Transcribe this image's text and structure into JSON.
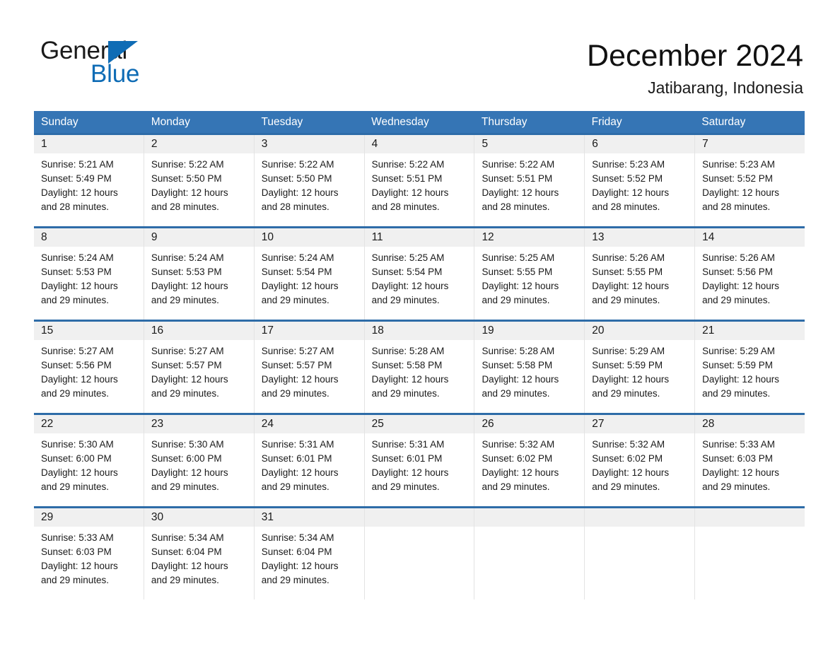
{
  "brand": {
    "name_part1": "General",
    "name_part2": "Blue",
    "accent_color": "#0f6cb5"
  },
  "header": {
    "title": "December 2024",
    "location": "Jatibarang, Indonesia"
  },
  "theme": {
    "header_blue": "#3575b5",
    "separator_blue": "#2e6ca8",
    "date_band_gray": "#f0f0f0"
  },
  "calendar": {
    "weekdays": [
      "Sunday",
      "Monday",
      "Tuesday",
      "Wednesday",
      "Thursday",
      "Friday",
      "Saturday"
    ],
    "labels": {
      "sunrise_prefix": "Sunrise:",
      "sunset_prefix": "Sunset:",
      "daylight_prefix": "Daylight:"
    },
    "weeks": [
      [
        {
          "date": "1",
          "sunrise": "Sunrise: 5:21 AM",
          "sunset": "Sunset: 5:49 PM",
          "daylight_line1": "Daylight: 12 hours",
          "daylight_line2": "and 28 minutes."
        },
        {
          "date": "2",
          "sunrise": "Sunrise: 5:22 AM",
          "sunset": "Sunset: 5:50 PM",
          "daylight_line1": "Daylight: 12 hours",
          "daylight_line2": "and 28 minutes."
        },
        {
          "date": "3",
          "sunrise": "Sunrise: 5:22 AM",
          "sunset": "Sunset: 5:50 PM",
          "daylight_line1": "Daylight: 12 hours",
          "daylight_line2": "and 28 minutes."
        },
        {
          "date": "4",
          "sunrise": "Sunrise: 5:22 AM",
          "sunset": "Sunset: 5:51 PM",
          "daylight_line1": "Daylight: 12 hours",
          "daylight_line2": "and 28 minutes."
        },
        {
          "date": "5",
          "sunrise": "Sunrise: 5:22 AM",
          "sunset": "Sunset: 5:51 PM",
          "daylight_line1": "Daylight: 12 hours",
          "daylight_line2": "and 28 minutes."
        },
        {
          "date": "6",
          "sunrise": "Sunrise: 5:23 AM",
          "sunset": "Sunset: 5:52 PM",
          "daylight_line1": "Daylight: 12 hours",
          "daylight_line2": "and 28 minutes."
        },
        {
          "date": "7",
          "sunrise": "Sunrise: 5:23 AM",
          "sunset": "Sunset: 5:52 PM",
          "daylight_line1": "Daylight: 12 hours",
          "daylight_line2": "and 28 minutes."
        }
      ],
      [
        {
          "date": "8",
          "sunrise": "Sunrise: 5:24 AM",
          "sunset": "Sunset: 5:53 PM",
          "daylight_line1": "Daylight: 12 hours",
          "daylight_line2": "and 29 minutes."
        },
        {
          "date": "9",
          "sunrise": "Sunrise: 5:24 AM",
          "sunset": "Sunset: 5:53 PM",
          "daylight_line1": "Daylight: 12 hours",
          "daylight_line2": "and 29 minutes."
        },
        {
          "date": "10",
          "sunrise": "Sunrise: 5:24 AM",
          "sunset": "Sunset: 5:54 PM",
          "daylight_line1": "Daylight: 12 hours",
          "daylight_line2": "and 29 minutes."
        },
        {
          "date": "11",
          "sunrise": "Sunrise: 5:25 AM",
          "sunset": "Sunset: 5:54 PM",
          "daylight_line1": "Daylight: 12 hours",
          "daylight_line2": "and 29 minutes."
        },
        {
          "date": "12",
          "sunrise": "Sunrise: 5:25 AM",
          "sunset": "Sunset: 5:55 PM",
          "daylight_line1": "Daylight: 12 hours",
          "daylight_line2": "and 29 minutes."
        },
        {
          "date": "13",
          "sunrise": "Sunrise: 5:26 AM",
          "sunset": "Sunset: 5:55 PM",
          "daylight_line1": "Daylight: 12 hours",
          "daylight_line2": "and 29 minutes."
        },
        {
          "date": "14",
          "sunrise": "Sunrise: 5:26 AM",
          "sunset": "Sunset: 5:56 PM",
          "daylight_line1": "Daylight: 12 hours",
          "daylight_line2": "and 29 minutes."
        }
      ],
      [
        {
          "date": "15",
          "sunrise": "Sunrise: 5:27 AM",
          "sunset": "Sunset: 5:56 PM",
          "daylight_line1": "Daylight: 12 hours",
          "daylight_line2": "and 29 minutes."
        },
        {
          "date": "16",
          "sunrise": "Sunrise: 5:27 AM",
          "sunset": "Sunset: 5:57 PM",
          "daylight_line1": "Daylight: 12 hours",
          "daylight_line2": "and 29 minutes."
        },
        {
          "date": "17",
          "sunrise": "Sunrise: 5:27 AM",
          "sunset": "Sunset: 5:57 PM",
          "daylight_line1": "Daylight: 12 hours",
          "daylight_line2": "and 29 minutes."
        },
        {
          "date": "18",
          "sunrise": "Sunrise: 5:28 AM",
          "sunset": "Sunset: 5:58 PM",
          "daylight_line1": "Daylight: 12 hours",
          "daylight_line2": "and 29 minutes."
        },
        {
          "date": "19",
          "sunrise": "Sunrise: 5:28 AM",
          "sunset": "Sunset: 5:58 PM",
          "daylight_line1": "Daylight: 12 hours",
          "daylight_line2": "and 29 minutes."
        },
        {
          "date": "20",
          "sunrise": "Sunrise: 5:29 AM",
          "sunset": "Sunset: 5:59 PM",
          "daylight_line1": "Daylight: 12 hours",
          "daylight_line2": "and 29 minutes."
        },
        {
          "date": "21",
          "sunrise": "Sunrise: 5:29 AM",
          "sunset": "Sunset: 5:59 PM",
          "daylight_line1": "Daylight: 12 hours",
          "daylight_line2": "and 29 minutes."
        }
      ],
      [
        {
          "date": "22",
          "sunrise": "Sunrise: 5:30 AM",
          "sunset": "Sunset: 6:00 PM",
          "daylight_line1": "Daylight: 12 hours",
          "daylight_line2": "and 29 minutes."
        },
        {
          "date": "23",
          "sunrise": "Sunrise: 5:30 AM",
          "sunset": "Sunset: 6:00 PM",
          "daylight_line1": "Daylight: 12 hours",
          "daylight_line2": "and 29 minutes."
        },
        {
          "date": "24",
          "sunrise": "Sunrise: 5:31 AM",
          "sunset": "Sunset: 6:01 PM",
          "daylight_line1": "Daylight: 12 hours",
          "daylight_line2": "and 29 minutes."
        },
        {
          "date": "25",
          "sunrise": "Sunrise: 5:31 AM",
          "sunset": "Sunset: 6:01 PM",
          "daylight_line1": "Daylight: 12 hours",
          "daylight_line2": "and 29 minutes."
        },
        {
          "date": "26",
          "sunrise": "Sunrise: 5:32 AM",
          "sunset": "Sunset: 6:02 PM",
          "daylight_line1": "Daylight: 12 hours",
          "daylight_line2": "and 29 minutes."
        },
        {
          "date": "27",
          "sunrise": "Sunrise: 5:32 AM",
          "sunset": "Sunset: 6:02 PM",
          "daylight_line1": "Daylight: 12 hours",
          "daylight_line2": "and 29 minutes."
        },
        {
          "date": "28",
          "sunrise": "Sunrise: 5:33 AM",
          "sunset": "Sunset: 6:03 PM",
          "daylight_line1": "Daylight: 12 hours",
          "daylight_line2": "and 29 minutes."
        }
      ],
      [
        {
          "date": "29",
          "sunrise": "Sunrise: 5:33 AM",
          "sunset": "Sunset: 6:03 PM",
          "daylight_line1": "Daylight: 12 hours",
          "daylight_line2": "and 29 minutes."
        },
        {
          "date": "30",
          "sunrise": "Sunrise: 5:34 AM",
          "sunset": "Sunset: 6:04 PM",
          "daylight_line1": "Daylight: 12 hours",
          "daylight_line2": "and 29 minutes."
        },
        {
          "date": "31",
          "sunrise": "Sunrise: 5:34 AM",
          "sunset": "Sunset: 6:04 PM",
          "daylight_line1": "Daylight: 12 hours",
          "daylight_line2": "and 29 minutes."
        },
        {
          "date": "",
          "sunrise": "",
          "sunset": "",
          "daylight_line1": "",
          "daylight_line2": ""
        },
        {
          "date": "",
          "sunrise": "",
          "sunset": "",
          "daylight_line1": "",
          "daylight_line2": ""
        },
        {
          "date": "",
          "sunrise": "",
          "sunset": "",
          "daylight_line1": "",
          "daylight_line2": ""
        },
        {
          "date": "",
          "sunrise": "",
          "sunset": "",
          "daylight_line1": "",
          "daylight_line2": ""
        }
      ]
    ]
  }
}
